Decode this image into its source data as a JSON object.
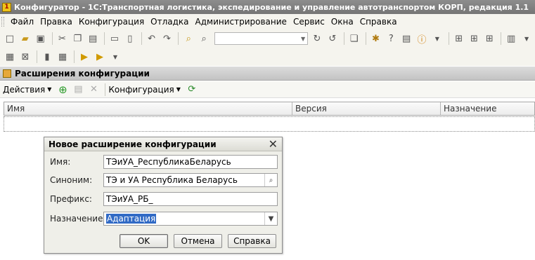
{
  "window": {
    "title": "Конфигуратор - 1С:Транспортная логистика, экспедирование и управление автотранспортом КОРП, редакция 1.1"
  },
  "menu": {
    "items": [
      "Файл",
      "Правка",
      "Конфигурация",
      "Отладка",
      "Администрирование",
      "Сервис",
      "Окна",
      "Справка"
    ]
  },
  "panel": {
    "title": "Расширения конфигурации",
    "actions_label": "Действия",
    "configuration_label": "Конфигурация"
  },
  "grid": {
    "columns": [
      "Имя",
      "Версия",
      "Назначение"
    ]
  },
  "dialog": {
    "title": "Новое расширение конфигурации",
    "fields": {
      "name": {
        "label": "Имя:",
        "value": "ТЭиУА_РеспубликаБеларусь"
      },
      "synonym": {
        "label": "Синоним:",
        "value": "ТЭ и УА Республика Беларусь"
      },
      "prefix": {
        "label": "Префикс:",
        "value": "ТЭиУА_РБ_"
      },
      "purpose": {
        "label": "Назначение:",
        "value": "Адаптация"
      }
    },
    "buttons": {
      "ok": "OK",
      "cancel": "Отмена",
      "help": "Справка"
    }
  }
}
